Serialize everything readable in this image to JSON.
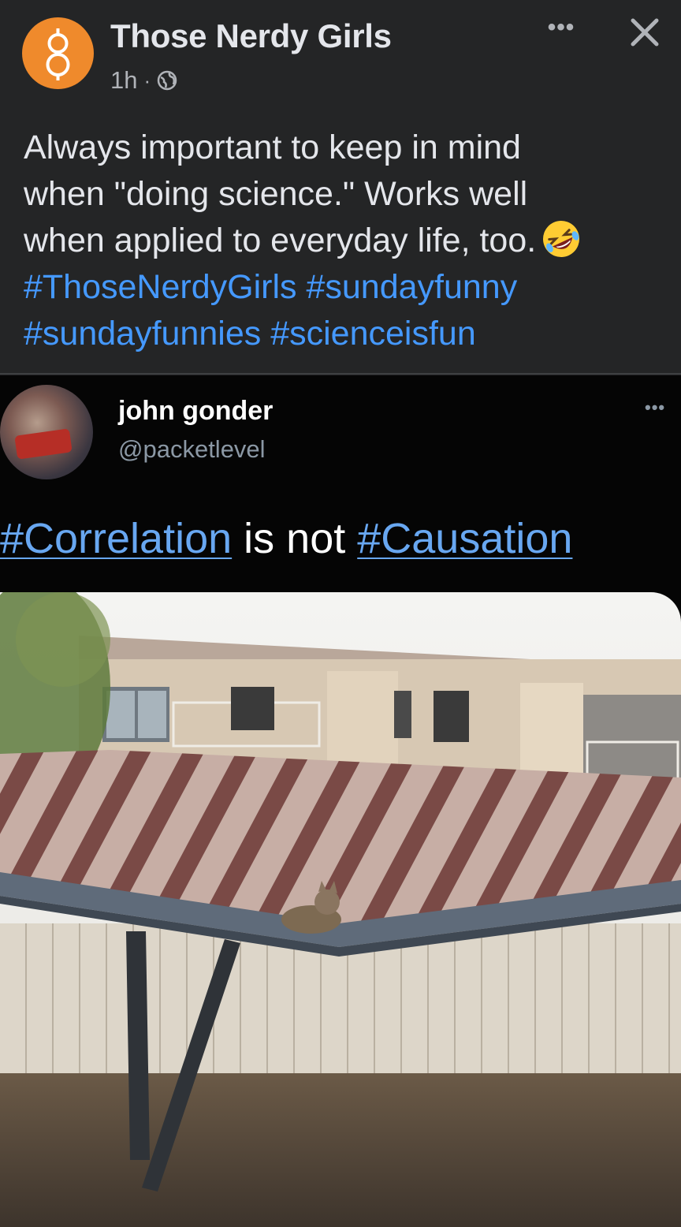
{
  "post": {
    "page_name": "Those Nerdy Girls",
    "time": "1h",
    "separator": "·",
    "audience_icon": "globe-icon",
    "more_label": "•••",
    "close_icon": "close-icon",
    "text_lines": [
      "Always important to keep in mind",
      "when \"doing science.\" Works well",
      "when applied to everyday life, too."
    ],
    "emoji": "rolling-on-floor-laughing-emoji",
    "hashtags_line1": [
      "#ThoseNerdyGirls",
      "#sundayfunny"
    ],
    "hashtags_line2": [
      "#sundayfunnies",
      "#scienceisfun"
    ]
  },
  "tweet": {
    "author": "john gonder",
    "handle": "@packetlevel",
    "more_label": "•••",
    "tag1": "#Correlation",
    "middle": " is not ",
    "tag2": "#Causation"
  },
  "colors": {
    "background": "#242526",
    "hashtag": "#4599ff",
    "tweet_background": "#050505",
    "avatar": "#ef8a2c"
  }
}
